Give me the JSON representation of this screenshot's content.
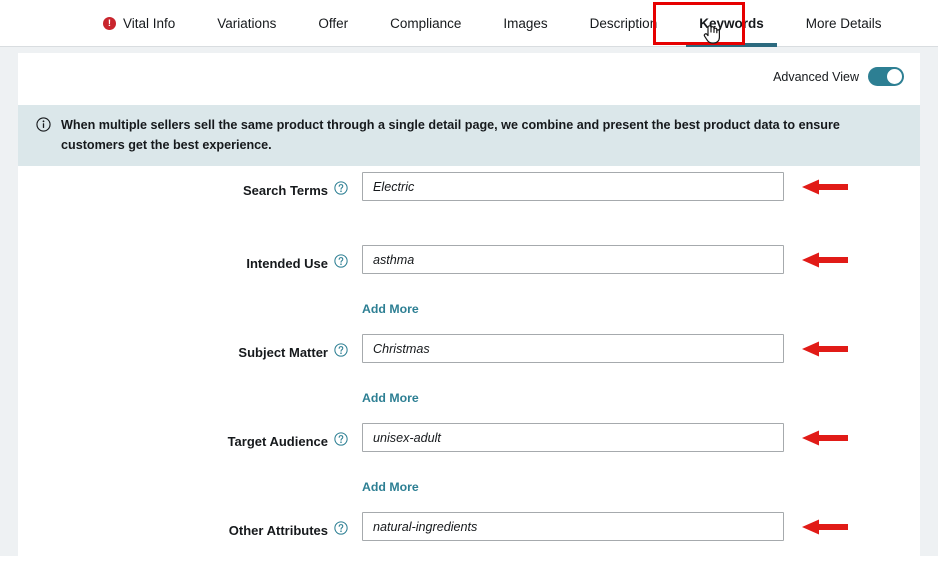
{
  "tabs": [
    {
      "label": "Vital Info",
      "icon": "alert-circle-icon",
      "has_alert": true,
      "active": false
    },
    {
      "label": "Variations",
      "has_alert": false,
      "active": false
    },
    {
      "label": "Offer",
      "has_alert": false,
      "active": false
    },
    {
      "label": "Compliance",
      "has_alert": false,
      "active": false
    },
    {
      "label": "Images",
      "has_alert": false,
      "active": false
    },
    {
      "label": "Description",
      "has_alert": false,
      "active": false
    },
    {
      "label": "Keywords",
      "has_alert": false,
      "active": true
    },
    {
      "label": "More Details",
      "has_alert": false,
      "active": false
    }
  ],
  "toolbar": {
    "advanced_view_label": "Advanced View",
    "advanced_view_on": true
  },
  "banner": {
    "icon": "info-circle-icon",
    "text": "When multiple sellers sell the same product through a single detail page, we combine and present the best product data to ensure customers get the best experience."
  },
  "fields": [
    {
      "label": "Search Terms",
      "value": "Electric",
      "placeholder": "Electric",
      "help_icon": "question-circle-icon",
      "add_more": null,
      "arrow": true
    },
    {
      "label": "Intended Use",
      "value": "asthma",
      "placeholder": "asthma",
      "help_icon": "question-circle-icon",
      "add_more": "Add More",
      "arrow": true
    },
    {
      "label": "Subject Matter",
      "value": "Christmas",
      "placeholder": "Christmas",
      "help_icon": "question-circle-icon",
      "add_more": "Add More",
      "arrow": true
    },
    {
      "label": "Target Audience",
      "value": "unisex-adult",
      "placeholder": "unisex-adult",
      "help_icon": "question-circle-icon",
      "add_more": "Add More",
      "arrow": true
    },
    {
      "label": "Other Attributes",
      "value": "natural-ingredients",
      "placeholder": "natural-ingredients",
      "help_icon": "question-circle-icon",
      "add_more": null,
      "arrow": true
    }
  ],
  "annotations": {
    "highlight_color": "#e60000",
    "arrow_color": "#e11b17",
    "accent_color": "#2d7f93",
    "alert_color": "#c9252d",
    "banner_bg": "#dbe7ea"
  },
  "cursor": {
    "type": "pointing-hand-cursor"
  }
}
